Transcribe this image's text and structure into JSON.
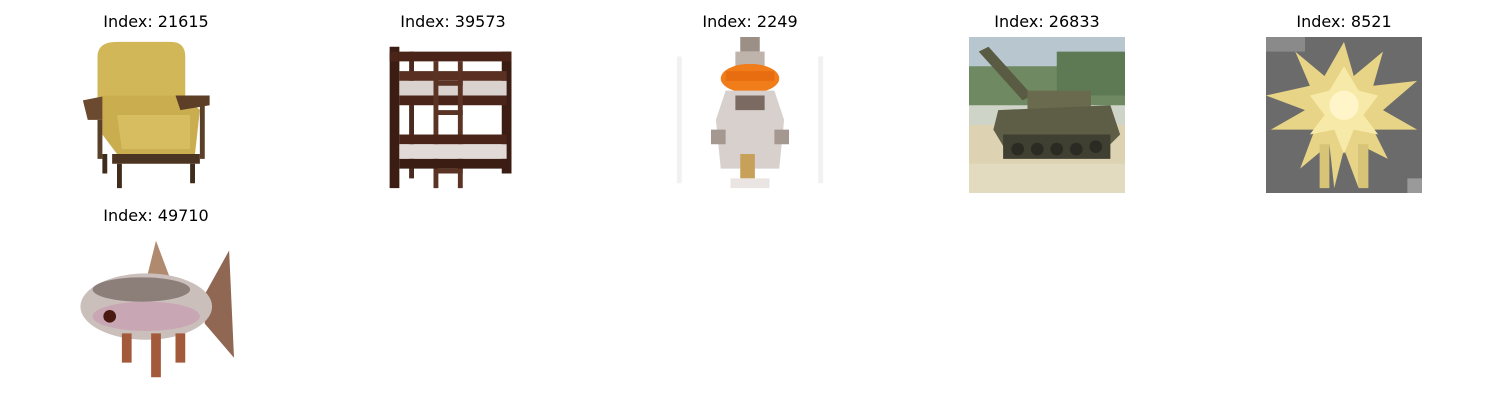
{
  "panels": [
    {
      "title": "Index: 21615",
      "image": "armchair"
    },
    {
      "title": "Index: 39573",
      "image": "bunk-bed"
    },
    {
      "title": "Index: 2249",
      "image": "figurine"
    },
    {
      "title": "Index: 26833",
      "image": "tank"
    },
    {
      "title": "Index: 8521",
      "image": "spiky-yellow-object"
    },
    {
      "title": "Index: 49710",
      "image": "fish"
    }
  ]
}
